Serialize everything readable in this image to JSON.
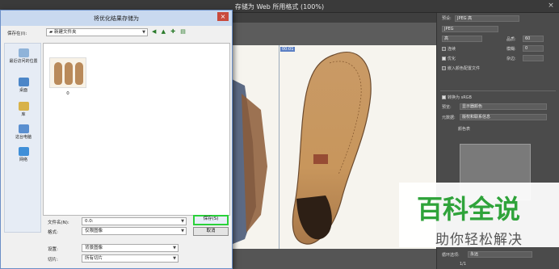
{
  "app": {
    "title": "存储为 Web 所用格式 (100%)",
    "close_glyph": "×"
  },
  "canvas": {
    "tag": "00:01"
  },
  "panel": {
    "preset_label": "预设:",
    "preset_value": "JPEG 高",
    "format_value": "JPEG",
    "quality_level": "高",
    "quality_label": "品质:",
    "quality_value": "60",
    "progressive_label": "连续",
    "blur_label": "模糊:",
    "blur_value": "0",
    "optimized_label": "优化",
    "matte_label": "杂边:",
    "embed_profile_label": "嵌入颜色配置文件",
    "convert_label": "转换为 sRGB",
    "preview_label": "预览:",
    "preview_value": "显示器颜色",
    "metadata_label": "元数据:",
    "metadata_value": "版权和联系信息",
    "color_table_label": "颜色表",
    "animation_label": "循环选项:",
    "animation_value": "永远",
    "page_value": "1/1"
  },
  "dialog": {
    "title": "将优化结果存储为",
    "close_glyph": "×",
    "save_in_label": "保存在(I):",
    "save_in_value": "新建文件夹",
    "nav_icons": "◀ ▲ ✚ ▤",
    "places": [
      {
        "label": "最近访问的位置",
        "icon_color": "#8fb3d9"
      },
      {
        "label": "桌面",
        "icon_color": "#4c86c8"
      },
      {
        "label": "库",
        "icon_color": "#d8b24a"
      },
      {
        "label": "这台电脑",
        "icon_color": "#5a8fd0"
      },
      {
        "label": "网络",
        "icon_color": "#3f8fd8"
      }
    ],
    "file_thumb_name": "0",
    "filename_label": "文件名(N):",
    "filename_value": "0.0:",
    "format_label": "格式:",
    "format_value": "仅限图像",
    "settings_label": "设置:",
    "settings_value": "背景图像",
    "slices_label": "切片:",
    "slices_value": "所有切片",
    "save_button": "保存(S)",
    "cancel_button": "取消"
  },
  "watermark": {
    "logo_text": "百科全说",
    "subtitle": "助你轻松解决"
  },
  "colors": {
    "accent_green": "#2ad13a",
    "watermark_green": "#2fa33a"
  }
}
